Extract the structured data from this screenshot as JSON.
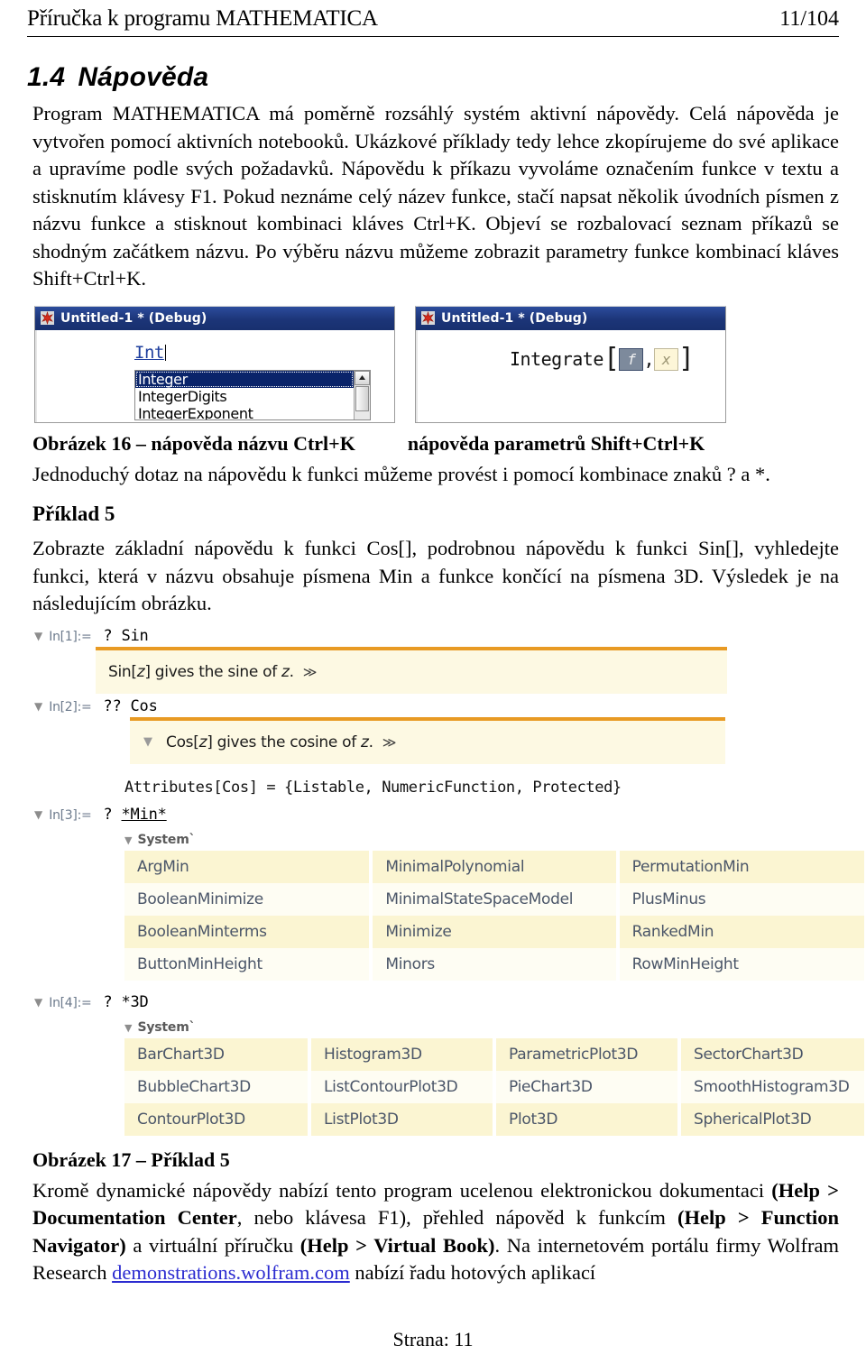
{
  "header": {
    "title": "Příručka k programu MATHEMATICA",
    "page_indicator": "11/104"
  },
  "section": {
    "number": "1.4",
    "title": "Nápověda"
  },
  "paragraphs": {
    "intro": "Program MATHEMATICA má poměrně rozsáhlý systém aktivní nápovědy. Celá nápověda je vytvořen pomocí aktivních notebooků. Ukázkové příklady tedy lehce zkopírujeme do své aplikace a upravíme podle svých požadavků. Nápovědu k příkazu vyvoláme označením funkce v textu a stisknutím klávesy F1. Pokud neznáme celý název funkce, stačí napsat několik úvodních písmen z názvu funkce a stisknout kombinaci kláves Ctrl+K. Objeví se rozbalovací seznam příkazů se shodným začátkem názvu. Po výběru názvu můžeme zobrazit parametry funkce kombinací kláves Shift+Ctrl+K.",
    "simple_query": "Jednoduchý dotaz na nápovědu k funkci můžeme provést i pomocí kombinace znaků ? a *.",
    "example5_body": "Zobrazte základní nápovědu k funkci Cos[], podrobnou nápovědu k funkci Sin[], vyhledejte funkci, která v názvu obsahuje písmena Min a funkce končící na písmena 3D. Výsledek je na následujícím obrázku."
  },
  "figure16": {
    "caption_left": "Obrázek 16 – nápověda názvu Ctrl+K",
    "caption_right": "nápověda parametrů Shift+Ctrl+K",
    "left_window": {
      "title": "Untitled-1 * (Debug)",
      "typed_text": "Int",
      "completion_items": [
        "Integer",
        "IntegerDigits",
        "IntegerExponent"
      ],
      "selected_index": 0
    },
    "right_window": {
      "title": "Untitled-1 * (Debug)",
      "function_name": "Integrate",
      "open_bracket": "[",
      "close_bracket": "]",
      "comma": ",",
      "placeholder_selected": "f",
      "placeholder_normal": "x"
    }
  },
  "example5": {
    "heading": "Příklad 5"
  },
  "figure17": {
    "caption": "Obrázek 17 – Příklad 5",
    "cells": [
      {
        "label": "In[1]:=",
        "code": "? Sin",
        "usage": "Sin[z] gives the sine of z.",
        "usage_fn": "Sin",
        "usage_var": "z",
        "more": "≫"
      },
      {
        "label": "In[2]:=",
        "code": "?? Cos",
        "usage": "Cos[z] gives the cosine of z.",
        "usage_fn": "Cos",
        "usage_var": "z",
        "more": "≫",
        "attributes": "Attributes[Cos] = {Listable, NumericFunction, Protected}"
      },
      {
        "label": "In[3]:=",
        "code": "? *Min*",
        "context": "System`",
        "grid": [
          [
            "ArgMin",
            "MinimalPolynomial",
            "PermutationMin"
          ],
          [
            "BooleanMinimize",
            "MinimalStateSpaceModel",
            "PlusMinus"
          ],
          [
            "BooleanMinterms",
            "Minimize",
            "RankedMin"
          ],
          [
            "ButtonMinHeight",
            "Minors",
            "RowMinHeight"
          ]
        ]
      },
      {
        "label": "In[4]:=",
        "code": "? *3D",
        "context": "System`",
        "grid": [
          [
            "BarChart3D",
            "Histogram3D",
            "ParametricPlot3D",
            "SectorChart3D"
          ],
          [
            "BubbleChart3D",
            "ListContourPlot3D",
            "PieChart3D",
            "SmoothHistogram3D"
          ],
          [
            "ContourPlot3D",
            "ListPlot3D",
            "Plot3D",
            "SphericalPlot3D"
          ]
        ]
      }
    ]
  },
  "closing": {
    "part1": "Kromě dynamické nápovědy nabízí tento program ucelenou elektronickou dokumentaci ",
    "bold1": "(Help > Documentation Center",
    "part2": ", nebo klávesa F1), přehled nápověd k funkcím ",
    "bold2": "(Help > Function Navigator)",
    "part3": " a virtuální příručku ",
    "bold3": "(Help > Virtual Book)",
    "part4": ". Na internetovém portálu firmy Wolfram Research ",
    "link": "demonstrations.wolfram.com",
    "part5": " nabízí řadu hotových aplikací"
  },
  "footer": {
    "text": "Strana: 11"
  },
  "colors": {
    "titlebar": "#1c3578",
    "selection": "#0a246a",
    "usage_bar": "#e89a23",
    "usage_bg": "#fdf9e3",
    "grid_odd": "#fbf5d2",
    "grid_even": "#fefdf3",
    "grid_text": "#4a5568",
    "link": "#2b2bd0"
  }
}
